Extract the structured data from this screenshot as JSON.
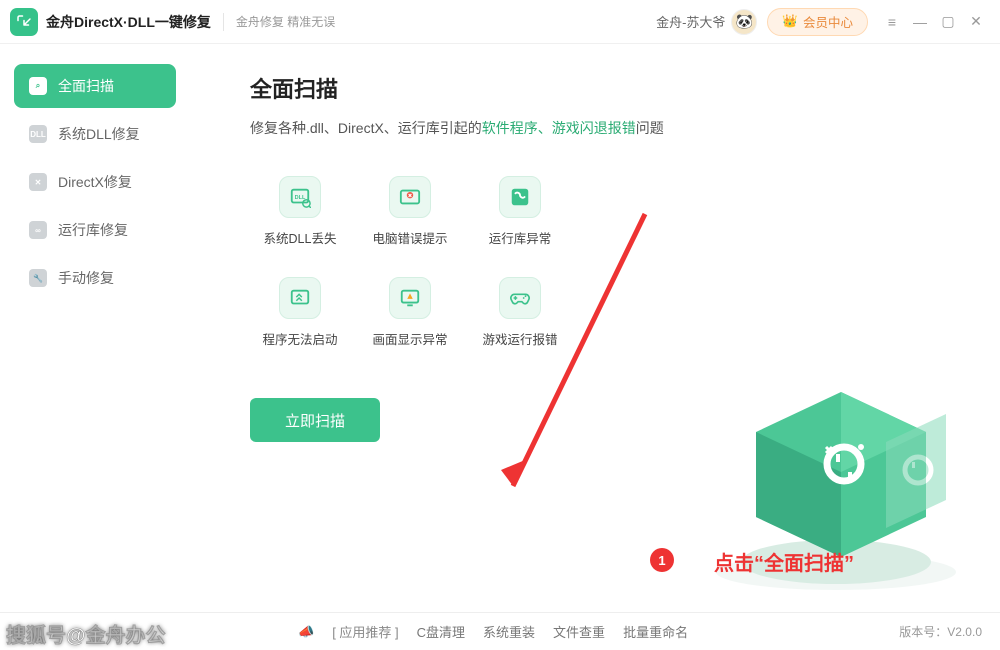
{
  "title_bar": {
    "app_title": "金舟DirectX·DLL一键修复",
    "tagline": "金舟修复 精准无误",
    "user_name": "金舟-苏大爷",
    "member_label": "会员中心"
  },
  "sidebar": {
    "items": [
      {
        "label": "全面扫描",
        "icon": "scan-icon",
        "active": true,
        "badge": ""
      },
      {
        "label": "系统DLL修复",
        "icon": "dll-icon",
        "active": false,
        "badge": "DLL"
      },
      {
        "label": "DirectX修复",
        "icon": "directx-icon",
        "active": false,
        "badge": "✕"
      },
      {
        "label": "运行库修复",
        "icon": "runtime-icon",
        "active": false,
        "badge": "∞"
      },
      {
        "label": "手动修复",
        "icon": "manual-icon",
        "active": false,
        "badge": "🔧"
      }
    ]
  },
  "main": {
    "heading": "全面扫描",
    "subtitle_prefix": "修复各种.dll、DirectX、运行库引起的",
    "subtitle_hl1": "软件程序、",
    "subtitle_hl2": "游戏闪退报错",
    "subtitle_suffix": "问题",
    "features": [
      {
        "label": "系统DLL丢失",
        "icon": "dll-loss-icon"
      },
      {
        "label": "电脑错误提示",
        "icon": "error-tip-icon"
      },
      {
        "label": "运行库异常",
        "icon": "runtime-err-icon"
      },
      {
        "label": "程序无法启动",
        "icon": "cant-start-icon"
      },
      {
        "label": "画面显示异常",
        "icon": "display-err-icon"
      },
      {
        "label": "游戏运行报错",
        "icon": "game-err-icon"
      }
    ],
    "scan_button_label": "立即扫描"
  },
  "annotation": {
    "number": "1",
    "text": "点击“全面扫描”"
  },
  "footer": {
    "promo_label": "[ 应用推荐 ]",
    "links": [
      "C盘清理",
      "系统重装",
      "文件查重",
      "批量重命名"
    ],
    "version_prefix": "版本号：",
    "version": "V2.0.0"
  },
  "watermark": "搜狐号@金舟办公",
  "colors": {
    "accent": "#3cc28c",
    "annotation": "#e33",
    "member_bg": "#fff2e6",
    "member_fg": "#e98a3c"
  }
}
